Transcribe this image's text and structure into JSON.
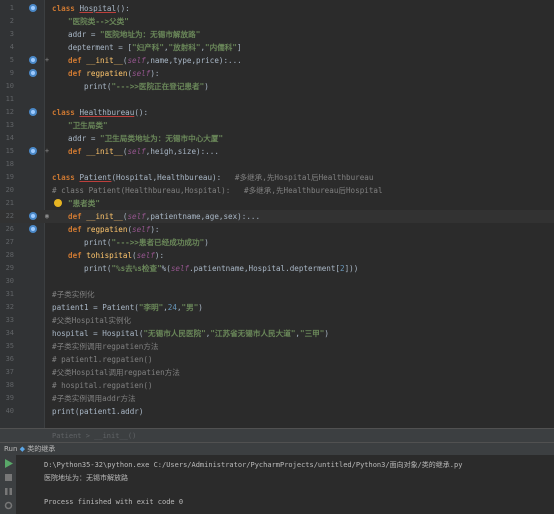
{
  "editor": {
    "lines": [
      {
        "n": "1",
        "tokens": [
          [
            "kw",
            "class "
          ],
          [
            "cls",
            "Hospital"
          ],
          [
            "p",
            "():"
          ]
        ]
      },
      {
        "n": "2",
        "tokens": [
          [
            "str",
            "\"医院类-->父类\""
          ]
        ]
      },
      {
        "n": "3",
        "tokens": [
          [
            "p",
            "addr = "
          ],
          [
            "str",
            "\"医院地址为：无锡市解放路\""
          ]
        ]
      },
      {
        "n": "4",
        "tokens": [
          [
            "p",
            "depterment = ["
          ],
          [
            "str",
            "\"妇产科\""
          ],
          [
            "p",
            ","
          ],
          [
            "str",
            "\"放射科\""
          ],
          [
            "p",
            ","
          ],
          [
            "str",
            "\"内儒科\""
          ],
          [
            "p",
            "]"
          ]
        ]
      },
      {
        "n": "5",
        "tokens": [
          [
            "kw",
            "def "
          ],
          [
            "fn",
            "__init__"
          ],
          [
            "p",
            "("
          ],
          [
            "self",
            "self"
          ],
          [
            "p",
            ",name,type,price):..."
          ]
        ]
      },
      {
        "n": "9",
        "tokens": [
          [
            "kw",
            "def "
          ],
          [
            "fn",
            "regpatien"
          ],
          [
            "p",
            "("
          ],
          [
            "self",
            "self"
          ],
          [
            "p",
            "):"
          ]
        ]
      },
      {
        "n": "10",
        "tokens": [
          [
            "p",
            "print("
          ],
          [
            "str",
            "\"--->>医院正在登记患者\""
          ],
          [
            "p",
            ")"
          ]
        ]
      },
      {
        "n": "11",
        "tokens": []
      },
      {
        "n": "12",
        "tokens": [
          [
            "kw",
            "class "
          ],
          [
            "cls",
            "Healthbureau"
          ],
          [
            "p",
            "():"
          ]
        ]
      },
      {
        "n": "13",
        "tokens": [
          [
            "str",
            "\"卫生局类\""
          ]
        ]
      },
      {
        "n": "14",
        "tokens": [
          [
            "p",
            "addr = "
          ],
          [
            "str",
            "\"卫生局类地址为：无锡市中心大厦\""
          ]
        ]
      },
      {
        "n": "15",
        "tokens": [
          [
            "kw",
            "def "
          ],
          [
            "fn",
            "__init__"
          ],
          [
            "p",
            "("
          ],
          [
            "self",
            "self"
          ],
          [
            "p",
            ",heigh,size):..."
          ]
        ]
      },
      {
        "n": "18",
        "tokens": []
      },
      {
        "n": "19",
        "tokens": [
          [
            "kw",
            "class "
          ],
          [
            "cls",
            "Patient"
          ],
          [
            "p",
            "(Hospital,Healthbureau):   "
          ],
          [
            "com",
            "#多继承,先Hospital后Healthbureau"
          ]
        ]
      },
      {
        "n": "20",
        "tokens": [
          [
            "com",
            "# class Patient(Healthbureau,Hospital):   #多继承,先Healthbureau后Hospital"
          ]
        ]
      },
      {
        "n": "21",
        "tokens": [
          [
            "str",
            "\"患者类\""
          ]
        ]
      },
      {
        "n": "22",
        "tokens": [
          [
            "kw",
            "def "
          ],
          [
            "fn",
            "__init__"
          ],
          [
            "p",
            "("
          ],
          [
            "self",
            "self"
          ],
          [
            "p",
            ",patientname,age,sex):..."
          ]
        ]
      },
      {
        "n": "26",
        "tokens": [
          [
            "kw",
            "def "
          ],
          [
            "fn",
            "regpatien"
          ],
          [
            "p",
            "("
          ],
          [
            "self",
            "self"
          ],
          [
            "p",
            "):"
          ]
        ]
      },
      {
        "n": "27",
        "tokens": [
          [
            "p",
            "print("
          ],
          [
            "str",
            "\"--->>患者已经成功成功\""
          ],
          [
            "p",
            ")"
          ]
        ]
      },
      {
        "n": "28",
        "tokens": [
          [
            "kw",
            "def "
          ],
          [
            "fn",
            "tohispital"
          ],
          [
            "p",
            "("
          ],
          [
            "self",
            "self"
          ],
          [
            "p",
            "):"
          ]
        ]
      },
      {
        "n": "29",
        "tokens": [
          [
            "p",
            "print("
          ],
          [
            "str",
            "\"%s去%s检查\""
          ],
          [
            "p",
            "%("
          ],
          [
            "self",
            "self"
          ],
          [
            "p",
            ".patientname,Hospital.depterment["
          ],
          [
            "num",
            "2"
          ],
          [
            "p",
            "]))"
          ]
        ]
      },
      {
        "n": "30",
        "tokens": []
      },
      {
        "n": "31",
        "tokens": [
          [
            "com",
            "#子类实例化"
          ]
        ]
      },
      {
        "n": "32",
        "tokens": [
          [
            "p",
            "patient1 = Patient("
          ],
          [
            "str",
            "\"李明\""
          ],
          [
            "p",
            ","
          ],
          [
            "num",
            "24"
          ],
          [
            "p",
            ","
          ],
          [
            "str",
            "\"男\""
          ],
          [
            "p",
            ")"
          ]
        ]
      },
      {
        "n": "33",
        "tokens": [
          [
            "com",
            "#父类Hospital实例化"
          ]
        ]
      },
      {
        "n": "34",
        "tokens": [
          [
            "p",
            "hospital = Hospital("
          ],
          [
            "str",
            "\"无锡市人民医院\""
          ],
          [
            "p",
            ","
          ],
          [
            "str",
            "\"江苏省无锡市人民大道\""
          ],
          [
            "p",
            ","
          ],
          [
            "str",
            "\"三甲\""
          ],
          [
            "p",
            ")"
          ]
        ]
      },
      {
        "n": "35",
        "tokens": [
          [
            "com",
            "#子类实例调用regpatien方法"
          ]
        ]
      },
      {
        "n": "36",
        "tokens": [
          [
            "com",
            "# patient1.regpatien()"
          ]
        ]
      },
      {
        "n": "37",
        "tokens": [
          [
            "com",
            "#父类Hospital调用regpatien方法"
          ]
        ]
      },
      {
        "n": "38",
        "tokens": [
          [
            "com",
            "# hospital.regpatien()"
          ]
        ]
      },
      {
        "n": "39",
        "tokens": [
          [
            "com",
            "#子类实例调用addr方法"
          ]
        ]
      },
      {
        "n": "40",
        "tokens": [
          [
            "p",
            "print(patient1.addr)"
          ]
        ]
      }
    ]
  },
  "breadcrumb": "Patient > __init__()",
  "run_panel": {
    "title": "Run",
    "config": "类的继承",
    "command": "D:\\Python35-32\\python.exe C:/Users/Administrator/PycharmProjects/untitled/Python3/面向对象/类的继承.py",
    "output_line": "医院地址为：无锡市解放路",
    "exit_message": "Process finished with exit code 0"
  }
}
